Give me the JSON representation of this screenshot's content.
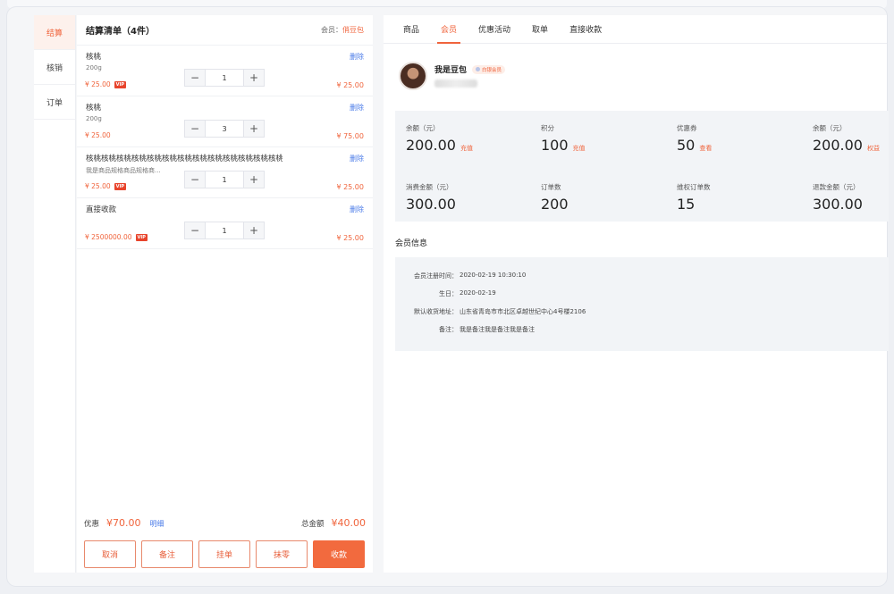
{
  "side_nav": [
    {
      "label": "结算",
      "active": true
    },
    {
      "label": "核销",
      "active": false
    },
    {
      "label": "订单",
      "active": false
    }
  ],
  "checkout": {
    "title": "结算清单（4件）",
    "member_label": "会员：",
    "member_name": "俏豆包",
    "items": [
      {
        "name": "核桃",
        "spec": "200g",
        "price": "¥ 25.00",
        "vip": "VIP",
        "qty": "1",
        "subtotal": "¥ 25.00",
        "delete": "删除"
      },
      {
        "name": "核桃",
        "spec": "200g",
        "price": "¥ 25.00",
        "vip": "",
        "qty": "3",
        "subtotal": "¥ 75.00",
        "delete": "删除"
      },
      {
        "name": "核桃核桃核桃核桃核桃核桃核桃核桃核桃核桃核桃核桃核桃核桃核桃核桃...",
        "spec": "我是商品规格商品规格商...",
        "price": "¥ 25.00",
        "vip": "VIP",
        "qty": "1",
        "subtotal": "¥ 25.00",
        "delete": "删除"
      },
      {
        "name": "直接收款",
        "spec": "",
        "price": "¥ 2500000.00",
        "vip": "VIP",
        "qty": "1",
        "subtotal": "¥ 25.00",
        "delete": "删除"
      }
    ],
    "discount_label": "优惠",
    "discount_value": "¥70.00",
    "detail_link": "明细",
    "total_label": "总金额",
    "total_value": "¥40.00",
    "actions": {
      "cancel": "取消",
      "remark": "备注",
      "hold": "挂单",
      "round": "抹零",
      "collect": "收款"
    }
  },
  "member_panel": {
    "tabs": [
      {
        "label": "商品",
        "active": false
      },
      {
        "label": "会员",
        "active": true
      },
      {
        "label": "优惠活动",
        "active": false
      },
      {
        "label": "取单",
        "active": false
      },
      {
        "label": "直接收款",
        "active": false
      }
    ],
    "profile": {
      "name": "我是豆包",
      "level": "白银会员"
    },
    "stats": [
      {
        "label": "余额（元）",
        "value": "200.00",
        "link": "充值"
      },
      {
        "label": "积分",
        "value": "100",
        "link": "充值"
      },
      {
        "label": "优惠券",
        "value": "50",
        "link": "查看"
      },
      {
        "label": "余额（元）",
        "value": "200.00",
        "link": "权益"
      },
      {
        "label": "消费金额（元）",
        "value": "300.00",
        "link": ""
      },
      {
        "label": "订单数",
        "value": "200",
        "link": ""
      },
      {
        "label": "维权订单数",
        "value": "15",
        "link": ""
      },
      {
        "label": "退款金额（元）",
        "value": "300.00",
        "link": ""
      }
    ],
    "info_title": "会员信息",
    "info": [
      {
        "key": "会员注册时间：",
        "value": "2020-02-19 10:30:10"
      },
      {
        "key": "生日：",
        "value": "2020-02-19"
      },
      {
        "key": "默认收货地址：",
        "value": "山东省青岛市市北区卓越世纪中心4号楼2106"
      },
      {
        "key": "备注：",
        "value": "我是备注我是备注我是备注"
      }
    ]
  }
}
